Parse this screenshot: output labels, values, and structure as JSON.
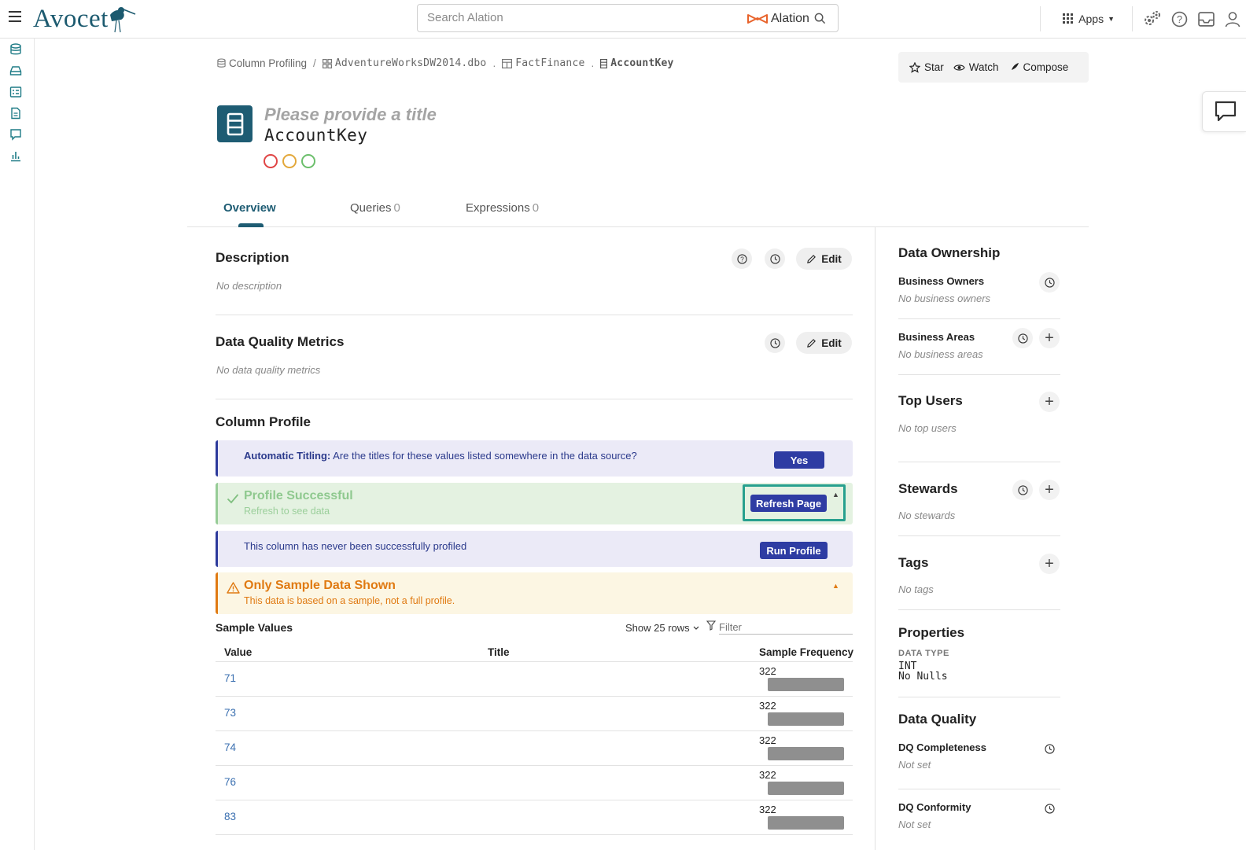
{
  "app": {
    "brand": "Avocet",
    "accent": "#1e5c73",
    "navy": "#2e3ca3"
  },
  "search": {
    "placeholder": "Search Alation",
    "brand_word": "Alation"
  },
  "topbar": {
    "apps_label": "Apps"
  },
  "breadcrumb": [
    {
      "label": "Column Profiling",
      "icon": "database-icon"
    },
    {
      "label": "AdventureWorksDW2014.dbo",
      "icon": "schema-icon"
    },
    {
      "label": "FactFinance",
      "icon": "table-icon"
    },
    {
      "label": "AccountKey",
      "icon": "column-icon"
    }
  ],
  "actions": {
    "star": "Star",
    "watch": "Watch",
    "compose": "Compose"
  },
  "header": {
    "title_placeholder": "Please provide a title",
    "name": "AccountKey",
    "trust_flags": [
      {
        "name": "deprecation",
        "color": "#e04545"
      },
      {
        "name": "warning",
        "color": "#e3a83b"
      },
      {
        "name": "endorsement",
        "color": "#6cbf6c"
      }
    ]
  },
  "tabs": [
    {
      "label": "Overview",
      "count": ""
    },
    {
      "label": "Queries",
      "count": "0"
    },
    {
      "label": "Expressions",
      "count": "0"
    }
  ],
  "description": {
    "title": "Description",
    "empty": "No description",
    "edit": "Edit"
  },
  "dq_metrics": {
    "title": "Data Quality Metrics",
    "empty": "No data quality metrics",
    "edit": "Edit"
  },
  "column_profile": {
    "title": "Column Profile",
    "auto_titling": {
      "label": "Automatic Titling:",
      "question": " Are the titles for these values listed somewhere in the data source?",
      "button": "Yes"
    },
    "success": {
      "title": "Profile Successful",
      "subtitle": "Refresh to see data",
      "button": "Refresh Page"
    },
    "never_profiled": {
      "text": "This column has never been successfully profiled",
      "button": "Run Profile"
    },
    "sample_warning": {
      "title": "Only Sample Data Shown",
      "subtitle": "This data is based on a sample, not a full profile."
    }
  },
  "sample_values": {
    "title": "Sample Values",
    "show_rows": "Show 25 rows",
    "filter_placeholder": "Filter",
    "columns": [
      "Value",
      "Title",
      "Sample Frequency"
    ],
    "rows": [
      {
        "value": "71",
        "title": "",
        "freq": "322",
        "fill": 1.0
      },
      {
        "value": "73",
        "title": "",
        "freq": "322",
        "fill": 1.0
      },
      {
        "value": "74",
        "title": "",
        "freq": "322",
        "fill": 1.0
      },
      {
        "value": "76",
        "title": "",
        "freq": "322",
        "fill": 1.0
      },
      {
        "value": "83",
        "title": "",
        "freq": "322",
        "fill": 1.0
      }
    ]
  },
  "right_panel": {
    "ownership_title": "Data Ownership",
    "business_owners": {
      "label": "Business Owners",
      "empty": "No business owners"
    },
    "business_areas": {
      "label": "Business Areas",
      "empty": "No business areas"
    },
    "top_users": {
      "title": "Top Users",
      "empty": "No top users"
    },
    "stewards": {
      "title": "Stewards",
      "empty": "No stewards"
    },
    "tags": {
      "title": "Tags",
      "empty": "No tags"
    },
    "properties": {
      "title": "Properties",
      "data_type_label": "DATA TYPE",
      "data_type": "INT",
      "nulls": "No Nulls"
    },
    "data_quality": {
      "title": "Data Quality",
      "completeness": {
        "label": "DQ Completeness",
        "value": "Not set"
      },
      "conformity": {
        "label": "DQ Conformity",
        "value": "Not set"
      }
    }
  }
}
